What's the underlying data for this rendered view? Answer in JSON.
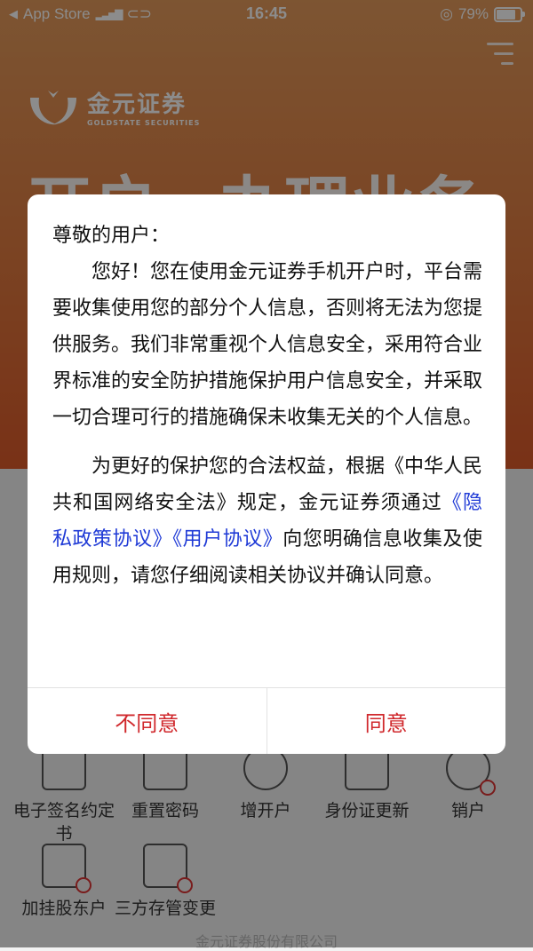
{
  "status_bar": {
    "back_app": "App Store",
    "time": "16:45",
    "battery": "79%"
  },
  "brand": {
    "name_cn": "金元证券",
    "name_en": "GOLDSTATE SECURITIES"
  },
  "hero": {
    "left": "开户",
    "right": "办理业务"
  },
  "dialog": {
    "greeting": "尊敬的用户：",
    "p1": "您好！您在使用金元证券手机开户时，平台需要收集使用您的部分个人信息，否则将无法为您提供服务。我们非常重视个人信息安全，采用符合业界标准的安全防护措施保护用户信息安全，并采取一切合理可行的措施确保未收集无关的个人信息。",
    "p2_before": "为更好的保护您的合法权益，根据《中华人民共和国网络安全法》规定，金元证券须通过",
    "link_privacy": "《隐私政策协议》",
    "link_user": "《用户协议》",
    "p2_after": "向您明确信息收集及使用规则，请您仔细阅读相关协议并确认同意。",
    "disagree": "不同意",
    "agree": "同意"
  },
  "services": [
    {
      "label": "电子签名约定书",
      "icon": "document-sign-icon"
    },
    {
      "label": "重置密码",
      "icon": "lock-reset-icon"
    },
    {
      "label": "增开户",
      "icon": "add-account-icon"
    },
    {
      "label": "身份证更新",
      "icon": "id-card-icon"
    },
    {
      "label": "销户",
      "icon": "user-remove-icon"
    },
    {
      "label": "加挂股东户",
      "icon": "add-shareholder-icon"
    },
    {
      "label": "三方存管变更",
      "icon": "bank-card-icon"
    }
  ],
  "footer": "金元证券股份有限公司"
}
